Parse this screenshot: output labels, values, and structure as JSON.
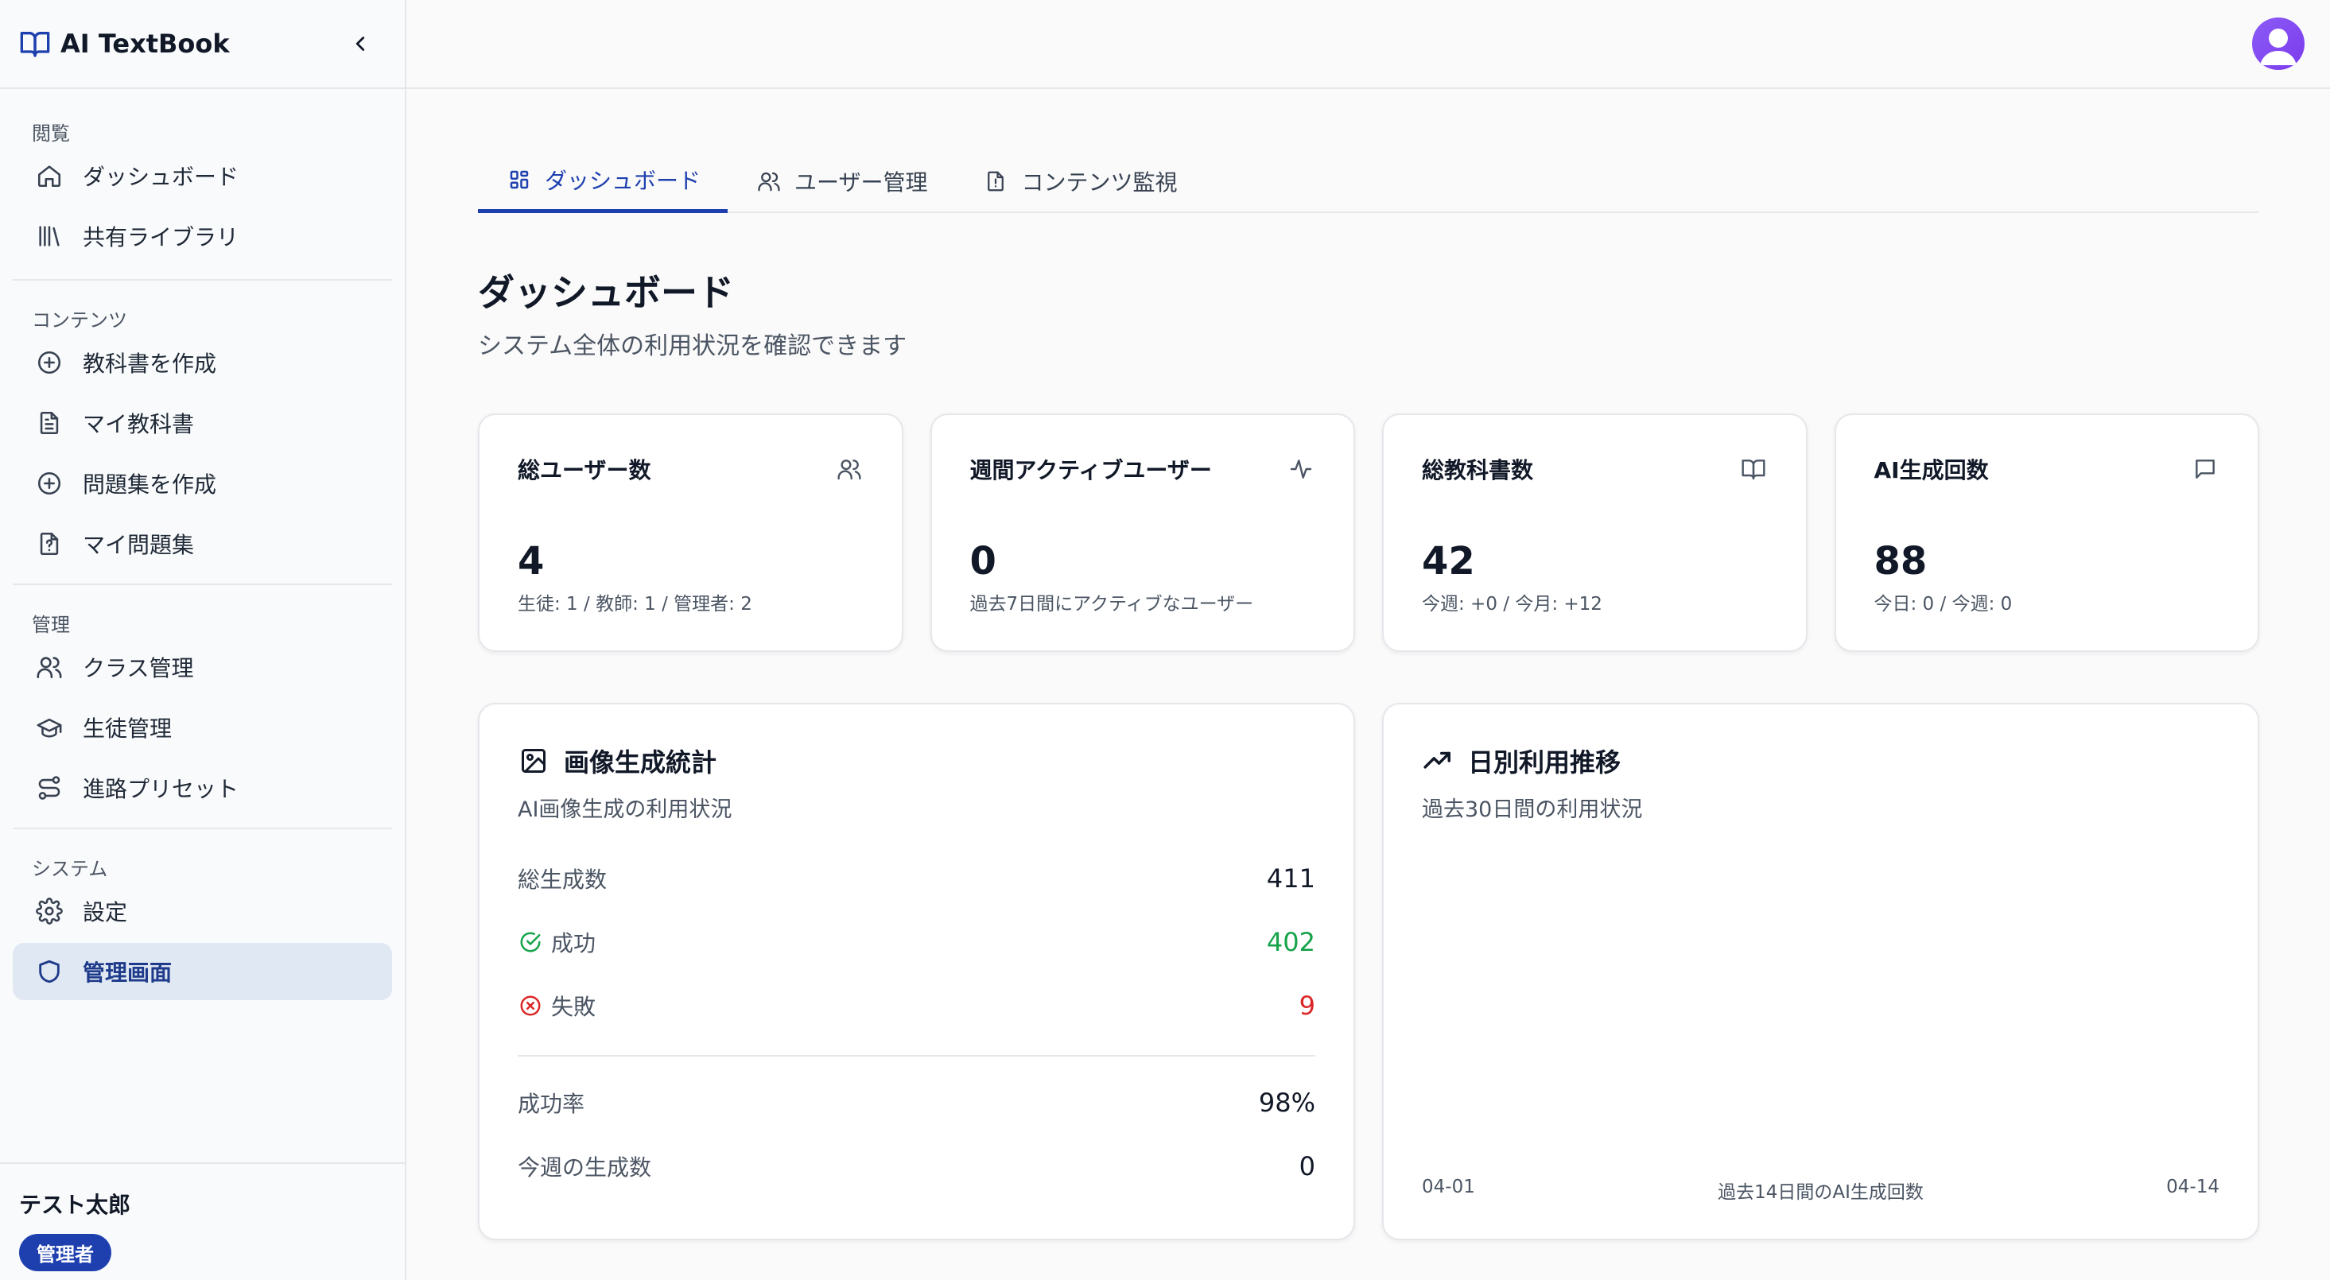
{
  "app": {
    "title": "AI TextBook"
  },
  "sidebar": {
    "sections": [
      {
        "label": "閲覧",
        "items": [
          {
            "label": "ダッシュボード",
            "icon": "home-icon"
          },
          {
            "label": "共有ライブラリ",
            "icon": "library-icon"
          }
        ]
      },
      {
        "label": "コンテンツ",
        "items": [
          {
            "label": "教科書を作成",
            "icon": "plus-circle-icon"
          },
          {
            "label": "マイ教科書",
            "icon": "document-icon"
          },
          {
            "label": "問題集を作成",
            "icon": "plus-circle-icon"
          },
          {
            "label": "マイ問題集",
            "icon": "question-file-icon"
          }
        ]
      },
      {
        "label": "管理",
        "items": [
          {
            "label": "クラス管理",
            "icon": "users-icon"
          },
          {
            "label": "生徒管理",
            "icon": "graduation-cap-icon"
          },
          {
            "label": "進路プリセット",
            "icon": "route-icon"
          }
        ]
      },
      {
        "label": "システム",
        "items": [
          {
            "label": "設定",
            "icon": "gear-icon"
          },
          {
            "label": "管理画面",
            "icon": "shield-icon",
            "active": true
          }
        ]
      }
    ],
    "user": {
      "name": "テスト太郎",
      "role": "管理者"
    }
  },
  "tabs": [
    {
      "label": "ダッシュボード",
      "icon": "grid-icon",
      "active": true
    },
    {
      "label": "ユーザー管理",
      "icon": "users-icon"
    },
    {
      "label": "コンテンツ監視",
      "icon": "alert-file-icon"
    }
  ],
  "page": {
    "title": "ダッシュボード",
    "subtitle": "システム全体の利用状況を確認できます"
  },
  "stats": [
    {
      "title": "総ユーザー数",
      "value": "4",
      "note": "生徒: 1 / 教師: 1 / 管理者: 2",
      "icon": "users-icon"
    },
    {
      "title": "週間アクティブユーザー",
      "value": "0",
      "note": "過去7日間にアクティブなユーザー",
      "icon": "activity-icon"
    },
    {
      "title": "総教科書数",
      "value": "42",
      "note": "今週: +0 / 今月: +12",
      "icon": "book-open-icon"
    },
    {
      "title": "AI生成回数",
      "value": "88",
      "note": "今日: 0 / 今週: 0",
      "icon": "message-icon"
    }
  ],
  "image_stats": {
    "title": "画像生成統計",
    "subtitle": "AI画像生成の利用状況",
    "total_label": "総生成数",
    "total_value": "411",
    "success_label": "成功",
    "success_value": "402",
    "fail_label": "失敗",
    "fail_value": "9",
    "rate_label": "成功率",
    "rate_value": "98%",
    "week_label": "今週の生成数",
    "week_value": "0"
  },
  "daily": {
    "title": "日別利用推移",
    "subtitle": "過去30日間の利用状況",
    "start": "04-01",
    "caption": "過去14日間のAI生成回数",
    "end": "04-14"
  },
  "colors": {
    "accent": "#1e40af",
    "active_bg": "#e0e8f3",
    "success": "#16a34a",
    "error": "#dc2626"
  }
}
